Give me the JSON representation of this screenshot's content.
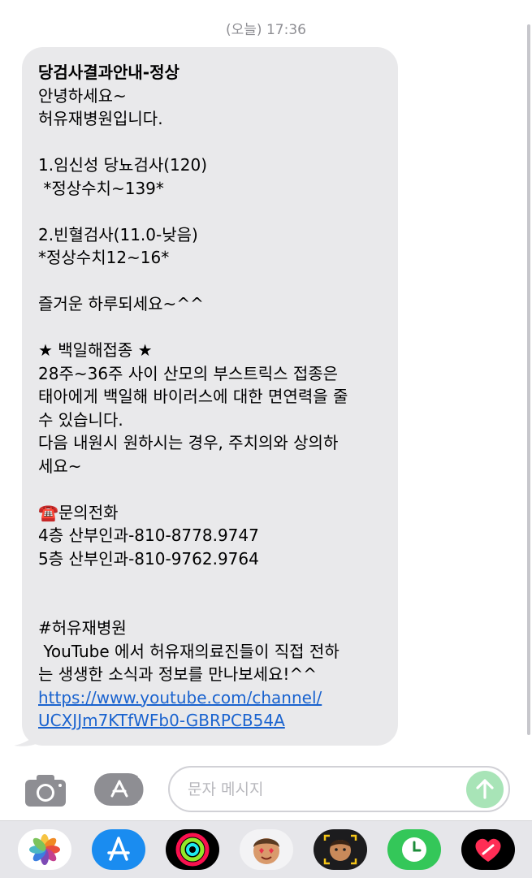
{
  "header": {
    "timestamp": "(오늘) 17:36"
  },
  "message": {
    "lines": [
      "당검사결과안내-정상",
      "안녕하세요~",
      "허유재병원입니다.",
      "",
      "1.임신성 당뇨검사(120)",
      " *정상수치~139*",
      "",
      "2.빈혈검사(11.0-낮음)",
      "*정상수치12~16*",
      "",
      "즐거운 하루되세요~^^",
      "",
      "★ 백일해접종 ★",
      "28주~36주 사이 산모의 부스트릭스 접종은",
      "태아에게 백일해 바이러스에 대한 면연력을 줄",
      "수 있습니다.",
      "다음 내원시 원하시는 경우, 주치의와 상의하",
      "세요~",
      "",
      "☎️문의전화",
      "4층 산부인과-810-8778.9747",
      "5층 산부인과-810-9762.9764",
      "",
      "",
      "#허유재병원",
      " YouTube 에서 허유재의료진들이 직접 전하",
      "는 생생한 소식과 정보를 만나보세요!^^",
      "https://www.youtube.com/channel/",
      "UCXJJm7KTfWFb0-GBRPCB54A"
    ]
  },
  "input_bar": {
    "camera_icon": "camera-icon",
    "apps_icon": "app-store-icon",
    "placeholder": "문자 메시지",
    "send_icon": "arrow-up-icon"
  },
  "dock": {
    "apps": [
      "photos",
      "app-store",
      "activity",
      "memoji",
      "memoji-camera",
      "find-my",
      "digital-touch"
    ]
  },
  "colors": {
    "bubble": "#e9e9eb",
    "link": "#1a63cf",
    "send": "#a8e4b7"
  }
}
